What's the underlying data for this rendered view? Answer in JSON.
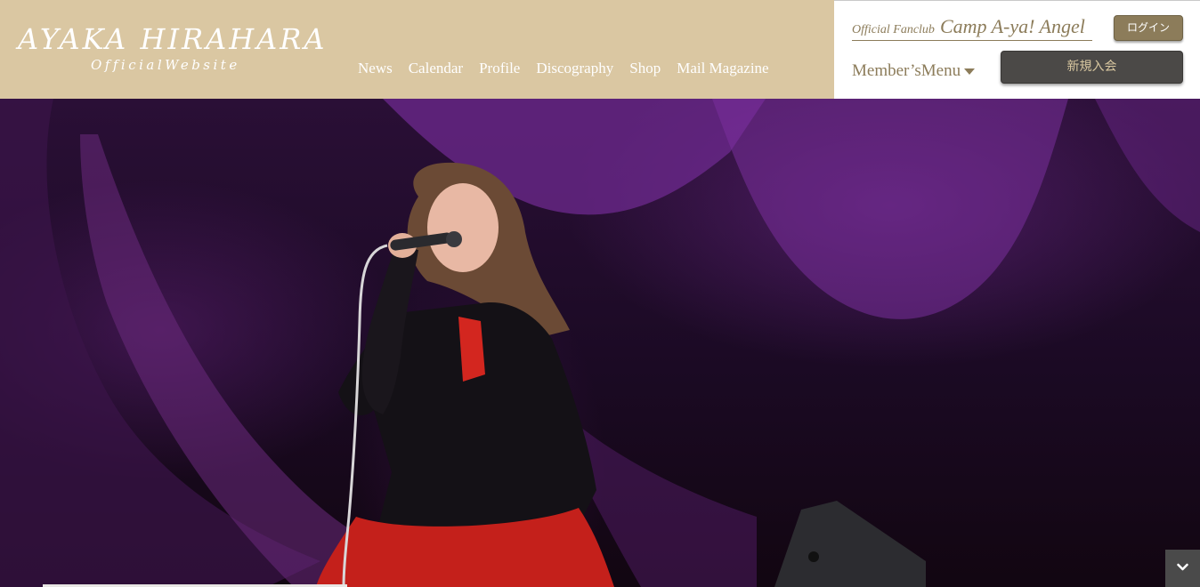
{
  "brand": {
    "name": "AYAKA HIRAHARA",
    "subtitle": "OfficialWebsite"
  },
  "nav": {
    "items": [
      "News",
      "Calendar",
      "Profile",
      "Discography",
      "Shop",
      "Mail Magazine"
    ]
  },
  "fanclub": {
    "label": "Official Fanclub",
    "name": "Camp A-ya! Angel",
    "login_label": "ログイン",
    "members_menu_label": "Member’sMenu",
    "join_label": "新規入会"
  },
  "hero": {
    "image_description_icon": "singer-photo",
    "slider_progress": 0.25
  },
  "icons": {
    "members_menu_caret": "caret-down-icon",
    "scroll_down": "chevron-down-icon"
  },
  "colors": {
    "brand_beige": "#dac7a2",
    "fanclub_gold": "#8c7c5a",
    "join_button": "#4b4947"
  }
}
